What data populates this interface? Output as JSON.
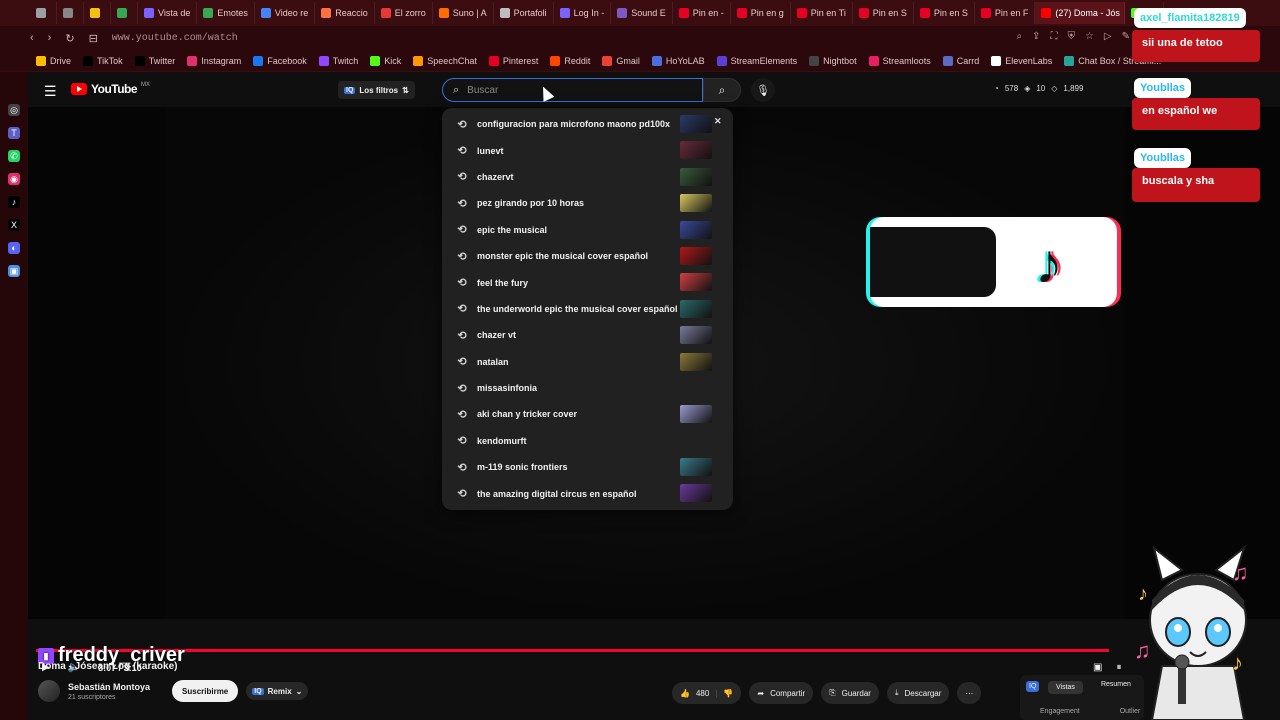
{
  "browser": {
    "tabs": [
      {
        "label": "",
        "color": "#9aa0a6"
      },
      {
        "label": "",
        "color": "#888888"
      },
      {
        "label": "",
        "color": "#f4c20d"
      },
      {
        "label": "",
        "color": "#34a853"
      },
      {
        "label": "Vista de",
        "color": "#7b61ff"
      },
      {
        "label": "Emotes",
        "color": "#34a853"
      },
      {
        "label": "Video re",
        "color": "#4285f4"
      },
      {
        "label": "Reaccio",
        "color": "#ff7043"
      },
      {
        "label": "El zorro",
        "color": "#e53935"
      },
      {
        "label": "Suno | A",
        "color": "#ff6d00"
      },
      {
        "label": "Portafoli",
        "color": "#bdbdbd"
      },
      {
        "label": "Log In -",
        "color": "#7b61ff"
      },
      {
        "label": "Sound E",
        "color": "#7e57c2"
      },
      {
        "label": "Pin en -",
        "color": "#e60023"
      },
      {
        "label": "Pin en g",
        "color": "#e60023"
      },
      {
        "label": "Pin en Ti",
        "color": "#e60023"
      },
      {
        "label": "Pin en S",
        "color": "#e60023"
      },
      {
        "label": "Pin en S",
        "color": "#e60023"
      },
      {
        "label": "Pin en F",
        "color": "#e60023"
      },
      {
        "label": "(27) Doma - Jós",
        "color": "#ff0000",
        "active": true
      },
      {
        "label": "Ch",
        "color": "#53fc18"
      }
    ],
    "url": "www.youtube.com/watch",
    "bookmarks": [
      {
        "label": "Drive",
        "color": "#fbbc04"
      },
      {
        "label": "TikTok",
        "color": "#000000"
      },
      {
        "label": "Twitter",
        "color": "#000000"
      },
      {
        "label": "Instagram",
        "color": "#e1306c"
      },
      {
        "label": "Facebook",
        "color": "#1877f2"
      },
      {
        "label": "Twitch",
        "color": "#9146ff"
      },
      {
        "label": "Kick",
        "color": "#53fc18"
      },
      {
        "label": "SpeechChat",
        "color": "#ff9800"
      },
      {
        "label": "Pinterest",
        "color": "#e60023"
      },
      {
        "label": "Reddit",
        "color": "#ff4500"
      },
      {
        "label": "Gmail",
        "color": "#ea4335"
      },
      {
        "label": "HoYoLAB",
        "color": "#4a6ee0"
      },
      {
        "label": "StreamElements",
        "color": "#5b3fd6"
      },
      {
        "label": "Nightbot",
        "color": "#444444"
      },
      {
        "label": "Streamloots",
        "color": "#e91e63"
      },
      {
        "label": "Carrd",
        "color": "#5c6bc0"
      },
      {
        "label": "ElevenLabs",
        "color": "#ffffff"
      },
      {
        "label": "Chat Box / Streaml...",
        "color": "#26a69a"
      }
    ]
  },
  "youtube": {
    "logo_text": "YouTube",
    "country": "MX",
    "filters_label": "Los filtros",
    "search_placeholder": "Buscar",
    "stats": [
      "578",
      "10",
      "1,899"
    ],
    "suggestions": [
      {
        "text": "configuracion para microfono maono pd100x",
        "thumb": "#2a3a6a",
        "removable": true
      },
      {
        "text": "lunevt",
        "thumb": "#6a2a3a"
      },
      {
        "text": "chazervt",
        "thumb": "#3a5a3a"
      },
      {
        "text": "pez girando por 10 horas",
        "thumb": "#d8c860"
      },
      {
        "text": "epic the musical",
        "thumb": "#3a4a9a"
      },
      {
        "text": "monster epic the musical cover español",
        "thumb": "#b01818"
      },
      {
        "text": "feel the fury",
        "thumb": "#d04040"
      },
      {
        "text": "the underworld epic the musical cover español",
        "thumb": "#2a6a6a"
      },
      {
        "text": "chazer vt",
        "thumb": "#7a7a9a"
      },
      {
        "text": "natalan",
        "thumb": "#8a7a3a"
      },
      {
        "text": "missasinfonia",
        "thumb": ""
      },
      {
        "text": "aki chan y tricker cover",
        "thumb": "#9a9ad0"
      },
      {
        "text": "kendomurft",
        "thumb": ""
      },
      {
        "text": "m-119 sonic frontiers",
        "thumb": "#3a7a8a"
      },
      {
        "text": "the amazing digital circus en español",
        "thumb": "#6a3a9a"
      }
    ],
    "player": {
      "time": "3:07 / 3:10",
      "progress": 0.984
    },
    "overlay_name": "freddy_criver",
    "video_title": "Doma - Jósean Log (karaoke)",
    "channel": {
      "name": "Sebastián Montoya",
      "subs": "21 suscriptores",
      "subscribe": "Suscribirme",
      "remix": "Remix"
    },
    "actions": {
      "likes": "480",
      "share": "Compartir",
      "save": "Guardar",
      "download": "Descargar"
    },
    "widget": {
      "tab1": "Vistas",
      "tab2": "Resumen",
      "b1": "Engagement",
      "b2": "Outlier"
    }
  },
  "stream_chat": [
    {
      "user": "axel_flamita182819",
      "msg": "sii una de tetoo"
    },
    {
      "user": "Youbllas",
      "msg": "en español we"
    },
    {
      "user": "Youbllas",
      "msg": "buscala y sha"
    }
  ]
}
